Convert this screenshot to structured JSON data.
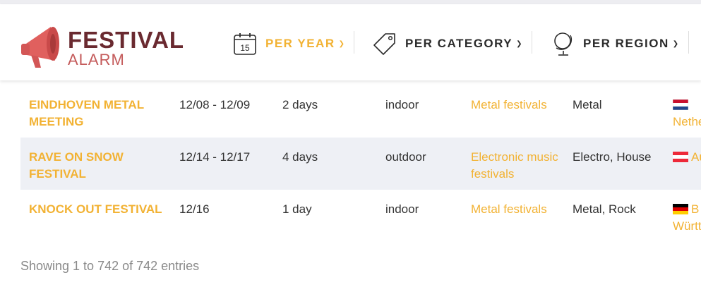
{
  "brand": {
    "title": "FESTIVAL",
    "subtitle": "ALARM",
    "colors": {
      "title": "#6a2a30",
      "subtitle": "#c45b5b",
      "accent": "#f2b233"
    }
  },
  "nav": {
    "per_year": {
      "label": "PER YEAR",
      "calendar_day": "15",
      "icon": "calendar-icon"
    },
    "per_category": {
      "label": "PER CATEGORY",
      "icon": "tag-icon"
    },
    "per_region": {
      "label": "PER REGION",
      "icon": "globe-icon"
    }
  },
  "rows": [
    {
      "name": "EINDHOVEN METAL MEETING",
      "dates": "12/08 - 12/09",
      "duration": "2 days",
      "venue": "indoor",
      "category": "Metal festivals",
      "genre": "Metal",
      "flag": "netherlands-flag-icon",
      "country": "Nethe"
    },
    {
      "name": "RAVE ON SNOW FESTIVAL",
      "dates": "12/14 - 12/17",
      "duration": "4 days",
      "venue": "outdoor",
      "category": "Electronic music festivals",
      "genre": "Electro, House",
      "flag": "austria-flag-icon",
      "country": "Au"
    },
    {
      "name": "KNOCK OUT FESTIVAL",
      "dates": "12/16",
      "duration": "1 day",
      "venue": "indoor",
      "category": "Metal festivals",
      "genre": "Metal, Rock",
      "flag": "germany-flag-icon",
      "country_line1": "B",
      "country_line2": "Württ"
    }
  ],
  "footer": {
    "entries_info": "Showing 1 to 742 of 742 entries"
  }
}
